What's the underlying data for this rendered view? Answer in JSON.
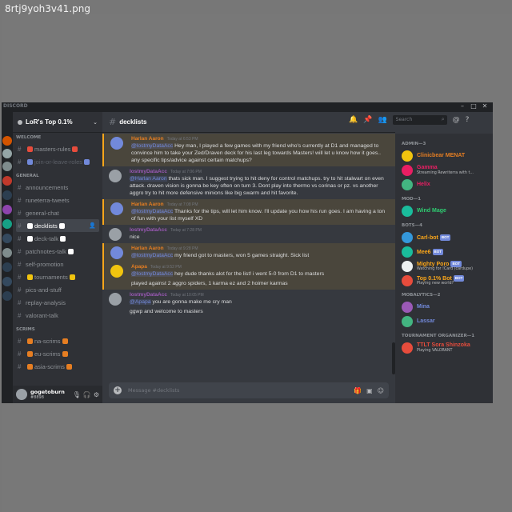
{
  "file_label": "8rtj9yoh3v41.png",
  "app_brand": "DISCORD",
  "window_controls": [
    "–",
    "□",
    "✕"
  ],
  "server": {
    "name": "LoR's Top 0.1%"
  },
  "channel_sidebar": {
    "categories": [
      {
        "name": "WELCOME",
        "channels": [
          "masters-rules",
          "join-or-leave-roles"
        ]
      },
      {
        "name": "GENERAL",
        "channels": [
          "announcements",
          "runeterra-tweets",
          "general-chat",
          "decklists",
          "deck-talk",
          "patchnotes-talk",
          "self-promotion",
          "tournaments",
          "pics-and-stuff",
          "replay-analysis",
          "valorant-talk"
        ]
      },
      {
        "name": "SCRIMS",
        "channels": [
          "na-scrims",
          "eu-scrims",
          "asia-scrims"
        ]
      }
    ],
    "active_channel": "decklists"
  },
  "user_panel": {
    "name": "gogetoburn",
    "tag": "#8898"
  },
  "chat": {
    "channel_name": "decklists",
    "composer_placeholder": "Message #decklists",
    "messages": [
      {
        "author": "Harlan Aaron",
        "author_color": "#e67e22",
        "time": "Today at 6:53 PM",
        "mention": "@lostmyDataAcc",
        "text": "Hey man, I played a few games with my friend who's currently at D1 and managed to convince him to take your Zed/Draven deck for his last leg towards Masters! will let u know how it goes.. any specific tips/advice against certain matchups?",
        "highlight": true,
        "avatar_color": "#7289da"
      },
      {
        "author": "lostmyDataAcc",
        "author_color": "#9b59b6",
        "time": "Today at 7:06 PM",
        "mention": "@Harlan Aaron",
        "text": "thats sick man. I suggest trying to hit deny for control matchups. try to hit stalwart on even attack. draven vision is gonna be key often on turn 3. Dont play into thermo vs corinas or pz. vs another aggro try to hit more defensive minions like big swarm and hit favorite.",
        "highlight": false,
        "avatar_color": "#9aa0a6"
      },
      {
        "author": "Harlan Aaron",
        "author_color": "#e67e22",
        "time": "Today at 7:08 PM",
        "mention": "@lostmyDataAcc",
        "text": "Thanks for the tips, will let him know. I'll update you how his run goes. I am having a ton of fun with your list myself XD",
        "highlight": true,
        "avatar_color": "#7289da"
      },
      {
        "author": "lostmyDataAcc",
        "author_color": "#9b59b6",
        "time": "Today at 7:28 PM",
        "mention": "",
        "text": "nice",
        "highlight": false,
        "avatar_color": "#9aa0a6"
      },
      {
        "author": "Harlan Aaron",
        "author_color": "#e67e22",
        "time": "Today at 9:28 PM",
        "mention": "@lostmyDataAcc",
        "text": "my friend got to masters, won 5 games straight. Sick list",
        "highlight": true,
        "avatar_color": "#7289da"
      },
      {
        "author": "Apapa",
        "author_color": "#e67e22",
        "time": "Today at 9:52 PM",
        "mention": "@lostmyDataAcc",
        "text": "hey dude thanks alot for the list! i went 5-0 from D1 to masters",
        "continuation": "played against 2 aggro spiders, 1 karma ez and 2 hoimer karmas",
        "highlight": true,
        "avatar_color": "#f1c40f"
      },
      {
        "author": "lostmyDataAcc",
        "author_color": "#9b59b6",
        "time": "Today at 10:05 PM",
        "mention": "@Apapa",
        "text": "you are gonna make me cry man",
        "continuation": "ggwp and welcome to masters",
        "highlight": false,
        "avatar_color": "#9aa0a6"
      }
    ]
  },
  "members": {
    "groups": [
      {
        "label": "ADMIN—3",
        "members": [
          {
            "name": "Clinicbear MENAT",
            "color": "#e67e22",
            "status": "",
            "bot": false,
            "avatar_color": "#f1c40f"
          },
          {
            "name": "Gamma",
            "color": "#e91e63",
            "status": "Streaming Rewriterra with t...",
            "bot": false,
            "avatar_color": "#e91e63"
          },
          {
            "name": "Helix",
            "color": "#e91e63",
            "status": "",
            "bot": false,
            "avatar_color": "#43b581"
          }
        ]
      },
      {
        "label": "MOD—1",
        "members": [
          {
            "name": "Wind Mage",
            "color": "#2ecc71",
            "status": "",
            "bot": false,
            "avatar_color": "#1abc9c"
          }
        ]
      },
      {
        "label": "BOTS—4",
        "members": [
          {
            "name": "Carl-bot",
            "color": "#faa61a",
            "status": "",
            "bot": true,
            "avatar_color": "#3498db"
          },
          {
            "name": "Mee6",
            "color": "#faa61a",
            "status": "",
            "bot": true,
            "avatar_color": "#1abc9c"
          },
          {
            "name": "Mighty Poro",
            "color": "#faa61a",
            "status": "Watching for !Card (cardupe)",
            "bot": true,
            "avatar_color": "#ecf0f1"
          },
          {
            "name": "Top 0.1% Bot",
            "color": "#faa61a",
            "status": "Playing new world?",
            "bot": true,
            "avatar_color": "#e74c3c"
          }
        ]
      },
      {
        "label": "MOBALYTICS—2",
        "members": [
          {
            "name": "Mina",
            "color": "#7289da",
            "status": "",
            "bot": false,
            "avatar_color": "#9b59b6"
          },
          {
            "name": "Lassar",
            "color": "#7289da",
            "status": "",
            "bot": false,
            "avatar_color": "#43b581"
          }
        ]
      },
      {
        "label": "TOURNAMENT ORGANIZER—1",
        "members": [
          {
            "name": "TTLT Sora Shinzoka",
            "color": "#e74c3c",
            "status": "Playing VALORANT",
            "bot": false,
            "avatar_color": "#e74c3c"
          }
        ]
      }
    ]
  },
  "search_placeholder": "Search",
  "bot_badge": "BOT"
}
